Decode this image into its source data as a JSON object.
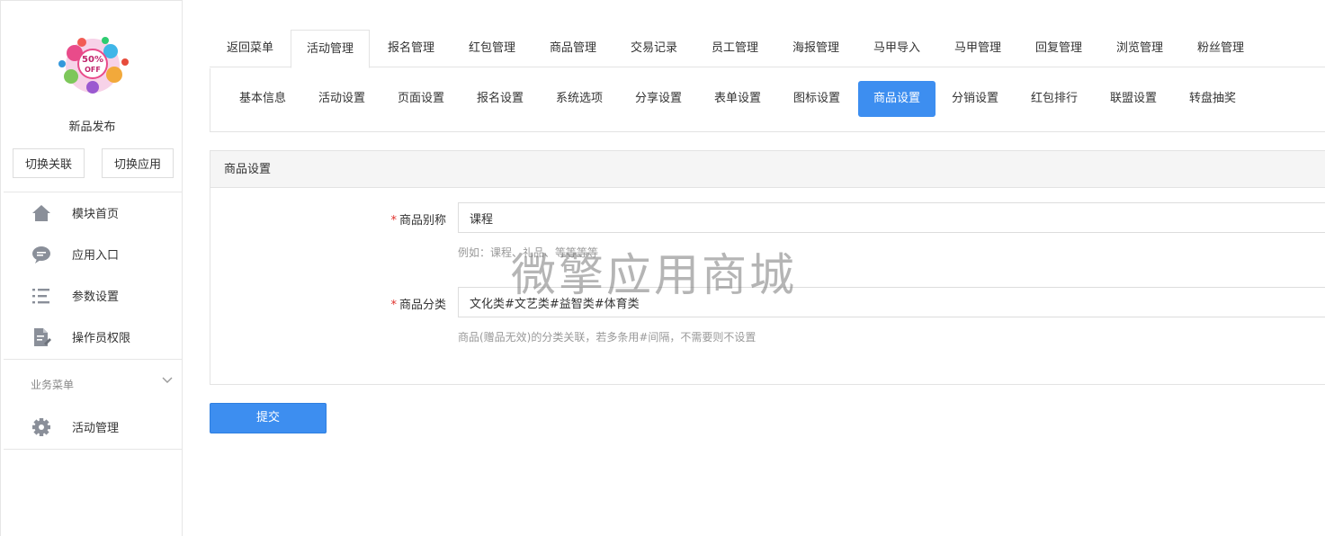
{
  "sidebar": {
    "app_name": "新品发布",
    "switch_buttons": [
      "切换关联",
      "切换应用"
    ],
    "items": [
      {
        "label": "模块首页",
        "icon": "home-icon"
      },
      {
        "label": "应用入口",
        "icon": "chat-bubble-icon"
      },
      {
        "label": "参数设置",
        "icon": "list-settings-icon"
      },
      {
        "label": "操作员权限",
        "icon": "document-edit-icon"
      }
    ],
    "section_label": "业务菜单",
    "section_items": [
      {
        "label": "活动管理",
        "icon": "gear-icon"
      }
    ]
  },
  "tabs": [
    "返回菜单",
    "活动管理",
    "报名管理",
    "红包管理",
    "商品管理",
    "交易记录",
    "员工管理",
    "海报管理",
    "马甲导入",
    "马甲管理",
    "回复管理",
    "浏览管理",
    "粉丝管理"
  ],
  "active_tab": "活动管理",
  "subtabs": [
    "基本信息",
    "活动设置",
    "页面设置",
    "报名设置",
    "系统选项",
    "分享设置",
    "表单设置",
    "图标设置",
    "商品设置",
    "分销设置",
    "红包排行",
    "联盟设置",
    "转盘抽奖"
  ],
  "active_subtab": "商品设置",
  "panel": {
    "title": "商品设置",
    "fields": [
      {
        "label": "商品别称",
        "value": "课程",
        "help": "例如：课程、礼品、等等等等"
      },
      {
        "label": "商品分类",
        "value": "文化类#文艺类#益智类#体育类",
        "help": "商品(赠品无效)的分类关联，若多条用#间隔，不需要则不设置"
      }
    ],
    "required_mark": "*"
  },
  "submit_label": "提交",
  "watermark": "微擎应用商城",
  "colors": {
    "accent": "#3d8ef0",
    "required": "#e0302b"
  }
}
